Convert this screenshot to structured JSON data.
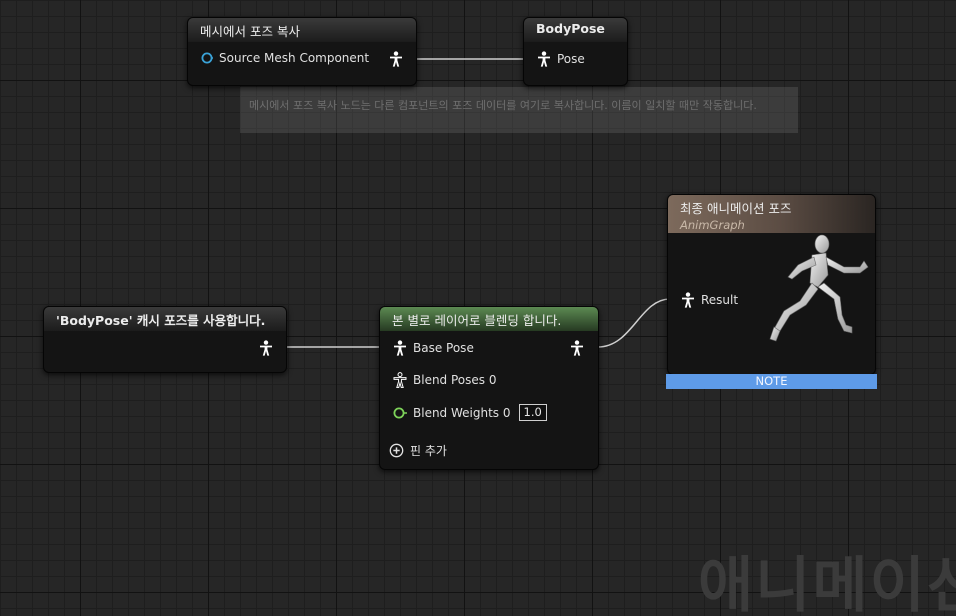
{
  "nodes": {
    "copy_pose": {
      "title": "메시에서 포즈 복사",
      "pin_source": "Source Mesh Component"
    },
    "body_pose": {
      "title": "BodyPose",
      "pin_pose": "Pose"
    },
    "cached_pose": {
      "title": "'BodyPose' 캐시 포즈를 사용합니다."
    },
    "layered_blend": {
      "title": "본 별로 레이어로 블렌딩 합니다.",
      "pin_base_pose": "Base Pose",
      "pin_blend_poses": "Blend Poses 0",
      "pin_blend_weights": "Blend Weights 0",
      "blend_weight_value": "1.0",
      "add_pin": "핀 추가"
    },
    "final_pose": {
      "title": "최종 애니메이션 포즈",
      "subtitle": "AnimGraph",
      "pin_result": "Result",
      "note": "NOTE"
    }
  },
  "comment": "메시에서 포즈 복사 노드는 다른 컴포넌트의 포즈 데이터를 여기로 복사합니다. 이름이 일치할 때만 작동합니다.",
  "watermark": "애니메이션",
  "colors": {
    "note_bar": "#5e9be8",
    "layered_header": "#5c8a52",
    "result_header": "#7d6a5c",
    "object_pin": "#3aa3d8",
    "float_pin": "#7ed35a"
  }
}
